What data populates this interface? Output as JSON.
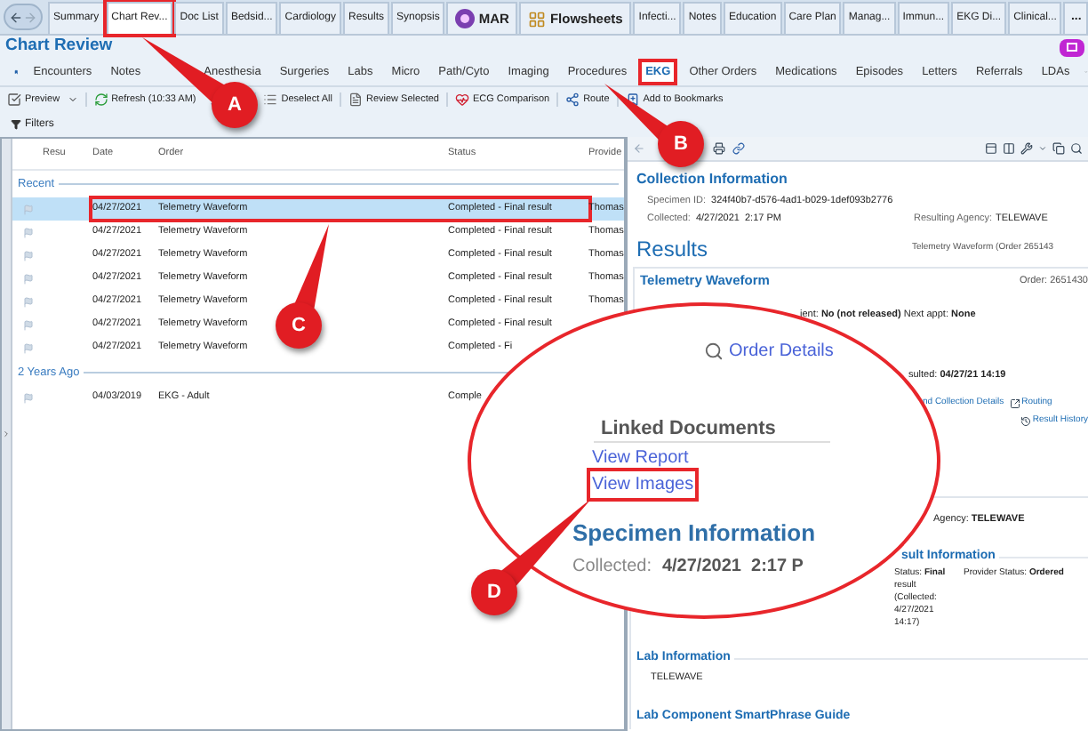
{
  "nav_tabs": [
    {
      "label": "Summary",
      "kind": "tab",
      "selected": false,
      "highlighted": false
    },
    {
      "label": "Chart Rev...",
      "kind": "tab",
      "selected": true,
      "highlighted": true
    },
    {
      "label": "Doc List",
      "kind": "tab",
      "selected": false,
      "highlighted": false
    },
    {
      "label": "Bedsid...",
      "kind": "tab",
      "selected": false,
      "highlighted": false
    },
    {
      "label": "Cardiology",
      "kind": "tab",
      "selected": false,
      "highlighted": false
    },
    {
      "label": "Results",
      "kind": "tab",
      "selected": false,
      "highlighted": false
    },
    {
      "label": "Synopsis",
      "kind": "tab",
      "selected": false,
      "highlighted": false
    },
    {
      "label": "MAR",
      "kind": "app",
      "selected": false,
      "highlighted": false
    },
    {
      "label": "Flowsheets",
      "kind": "app",
      "selected": false,
      "highlighted": false
    },
    {
      "label": "Infecti...",
      "kind": "tab",
      "selected": false,
      "highlighted": false
    },
    {
      "label": "Notes",
      "kind": "tab",
      "selected": false,
      "highlighted": false
    },
    {
      "label": "Education",
      "kind": "tab",
      "selected": false,
      "highlighted": false
    },
    {
      "label": "Care Plan",
      "kind": "tab",
      "selected": false,
      "highlighted": false
    },
    {
      "label": "Manag...",
      "kind": "tab",
      "selected": false,
      "highlighted": false
    },
    {
      "label": "Immun...",
      "kind": "tab",
      "selected": false,
      "highlighted": false
    },
    {
      "label": "EKG Di...",
      "kind": "tab",
      "selected": false,
      "highlighted": false
    },
    {
      "label": "Clinical...",
      "kind": "tab",
      "selected": false,
      "highlighted": false
    }
  ],
  "nav_more": "...",
  "page_title": "Chart Review",
  "activity_tabs": [
    {
      "label": "Encounters",
      "selected": false,
      "highlighted": false
    },
    {
      "label": "Notes",
      "selected": false,
      "highlighted": false
    },
    {
      "label": "Anesthesia",
      "selected": false,
      "highlighted": false
    },
    {
      "label": "Surgeries",
      "selected": false,
      "highlighted": false
    },
    {
      "label": "Labs",
      "selected": false,
      "highlighted": false
    },
    {
      "label": "Micro",
      "selected": false,
      "highlighted": false
    },
    {
      "label": "Path/Cyto",
      "selected": false,
      "highlighted": false
    },
    {
      "label": "Imaging",
      "selected": false,
      "highlighted": false
    },
    {
      "label": "Procedures",
      "selected": false,
      "highlighted": false
    },
    {
      "label": "EKG",
      "selected": true,
      "highlighted": true
    },
    {
      "label": "Other Orders",
      "selected": false,
      "highlighted": false
    },
    {
      "label": "Medications",
      "selected": false,
      "highlighted": false
    },
    {
      "label": "Episodes",
      "selected": false,
      "highlighted": false
    },
    {
      "label": "Letters",
      "selected": false,
      "highlighted": false
    },
    {
      "label": "Referrals",
      "selected": false,
      "highlighted": false
    },
    {
      "label": "LDAs",
      "selected": false,
      "highlighted": false
    }
  ],
  "toolbar": [
    {
      "label": "Preview",
      "kind": "dropdown"
    },
    {
      "label": "Refresh (10:33 AM)",
      "kind": "button"
    },
    {
      "label": "Deselect All",
      "kind": "button"
    },
    {
      "label": "Review Selected",
      "kind": "button"
    },
    {
      "label": "ECG Comparison",
      "kind": "button"
    },
    {
      "label": "Route",
      "kind": "button"
    },
    {
      "label": "Add to Bookmarks",
      "kind": "button"
    }
  ],
  "filters": "Filters",
  "table": {
    "columns": [
      "Resu",
      "Date",
      "Order",
      "Status",
      "Provide"
    ],
    "groups": [
      {
        "label": "Recent",
        "rows": [
          {
            "date": "04/27/2021",
            "order": "Telemetry Waveform",
            "status": "Completed - Final result",
            "provider": "Thomas",
            "selected": true,
            "highlighted": true
          },
          {
            "date": "04/27/2021",
            "order": "Telemetry Waveform",
            "status": "Completed - Final result",
            "provider": "Thomas",
            "selected": false,
            "highlighted": false
          },
          {
            "date": "04/27/2021",
            "order": "Telemetry Waveform",
            "status": "Completed - Final result",
            "provider": "Thomas",
            "selected": false,
            "highlighted": false
          },
          {
            "date": "04/27/2021",
            "order": "Telemetry Waveform",
            "status": "Completed - Final result",
            "provider": "Thomas",
            "selected": false,
            "highlighted": false
          },
          {
            "date": "04/27/2021",
            "order": "Telemetry Waveform",
            "status": "Completed - Final result",
            "provider": "Thomas",
            "selected": false,
            "highlighted": false
          },
          {
            "date": "04/27/2021",
            "order": "Telemetry Waveform",
            "status": "Completed - Final result",
            "selected": false,
            "highlighted": false
          },
          {
            "date": "04/27/2021",
            "order": "Telemetry Waveform",
            "status": "Completed - Fi",
            "selected": false,
            "highlighted": false
          }
        ]
      },
      {
        "label": "2 Years Ago",
        "rows": [
          {
            "date": "04/03/2019",
            "order": "EKG - Adult",
            "status": "Comple",
            "selected": false,
            "highlighted": false
          }
        ]
      }
    ]
  },
  "report": {
    "collection_heading": "Collection Information",
    "specimen_id": {
      "label": "Specimen ID:",
      "value": "324f40b7-d576-4ad1-b029-1def093b2776"
    },
    "collected": {
      "label": "Collected:",
      "value": "4/27/2021  2:17 PM"
    },
    "resulting_agency": {
      "label": "Resulting Agency:",
      "value": "TELEWAVE"
    },
    "results_heading": "Results",
    "results_order": "Telemetry Waveform (Order 265143",
    "card_title": "Telemetry Waveform",
    "card_order": "Order: 2651430",
    "patient_line": "ient: **No (not released)** Next appt: **None**",
    "resulted_line": "sulted: **04/27/21 14:19**",
    "collection_details_link": "nd Collection Details",
    "routing_link": "Routing",
    "result_history_link": "Result History",
    "agency_line": "Agency: **TELEWAVE**",
    "result_info_heading": "sult Information",
    "status_line": "Status: **Final** result (Collected: 4/27/2021 14:17)",
    "provider_status_line": "Provider Status: **Ordered**",
    "lab_info_heading": "Lab Information",
    "lab_info_value": "TELEWAVE",
    "smartphrase_heading": "Lab Component SmartPhrase Guide"
  },
  "magnifier": {
    "order_details": "Order Details",
    "linked_heading": "Linked Documents",
    "links": [
      {
        "label": "View Report",
        "highlighted": false
      },
      {
        "label": "View Images",
        "highlighted": true
      }
    ],
    "specimen_heading": "Specimen Information",
    "collected_label": "Collected:",
    "collected_value": "4/27/2021  2:17 P"
  },
  "callouts": [
    {
      "label": "A"
    },
    {
      "label": "B"
    },
    {
      "label": "C"
    },
    {
      "label": "D"
    }
  ]
}
